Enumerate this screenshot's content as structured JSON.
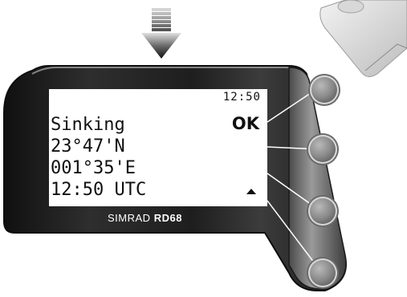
{
  "device": {
    "brand_prefix": "SIMRAD",
    "brand_model": "RD68"
  },
  "screen": {
    "clock": "12:50",
    "line1": "Sinking",
    "line2": "23°47'N",
    "line3": "001°35'E",
    "line4": "12:50 UTC",
    "ok_label": "OK",
    "scroll_indicator_icon": "triangle-up-icon"
  },
  "softkeys": [
    {
      "name": "softkey-1"
    },
    {
      "name": "softkey-2"
    },
    {
      "name": "softkey-3"
    },
    {
      "name": "softkey-4"
    }
  ],
  "colors": {
    "bezel_dark": "#1a1a1a",
    "bezel_light": "#8c8c8c",
    "screen_bg": "#ffffff",
    "text": "#101010"
  }
}
